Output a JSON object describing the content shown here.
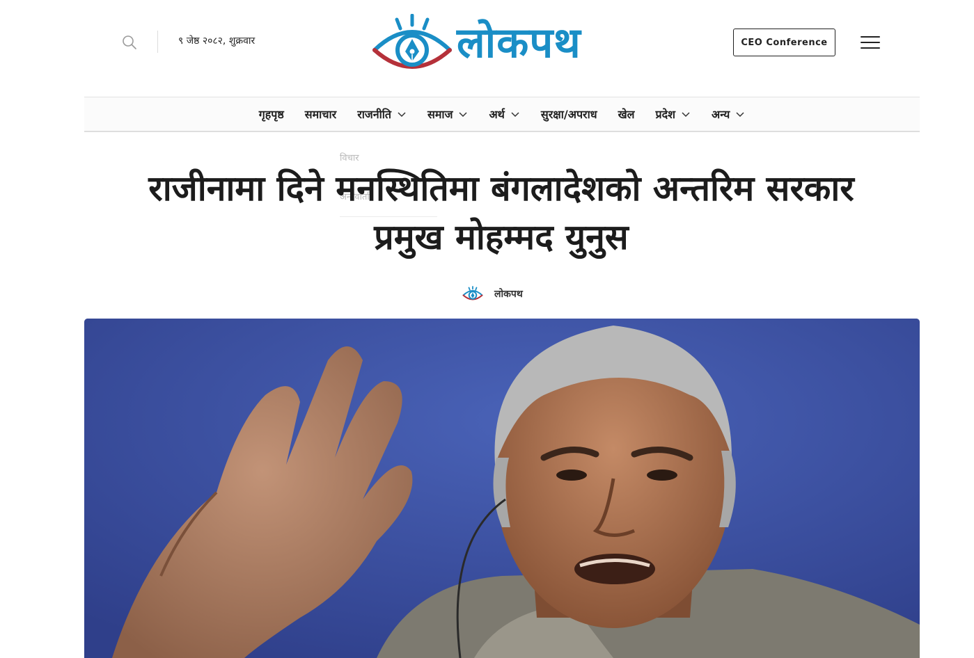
{
  "header": {
    "date": "९ जेष्ठ २०८२, शुक्रवार",
    "logo_text": "लोकपथ",
    "ceo_button": "CEO Conference"
  },
  "nav": {
    "items": [
      {
        "label": "गृहपृष्ठ",
        "dropdown": false
      },
      {
        "label": "समाचार",
        "dropdown": false
      },
      {
        "label": "राजनीति",
        "dropdown": true
      },
      {
        "label": "समाज",
        "dropdown": true
      },
      {
        "label": "अर्थ",
        "dropdown": true
      },
      {
        "label": "सुरक्षा/अपराध",
        "dropdown": false
      },
      {
        "label": "खेल",
        "dropdown": false
      },
      {
        "label": "प्रदेश",
        "dropdown": true
      },
      {
        "label": "अन्य",
        "dropdown": true
      }
    ],
    "dropdown_ghost": [
      "विचार",
      "अन्तर्वार्ता"
    ]
  },
  "article": {
    "title_line1": "राजीनामा दिने मनस्थितिमा बंगलादेशको अन्तरिम सरकार",
    "title_line2": "प्रमुख मोहम्मद युनुस",
    "author": "लोकपथ",
    "hero_alt": "मोहम्मद युनुस"
  },
  "colors": {
    "brand_blue": "#1a8ec6",
    "brand_red": "#b5313a",
    "hero_bg": "#3b51a5"
  },
  "icons": [
    "search-icon",
    "menu-icon",
    "chevron-down-icon",
    "logo-eye-icon"
  ]
}
